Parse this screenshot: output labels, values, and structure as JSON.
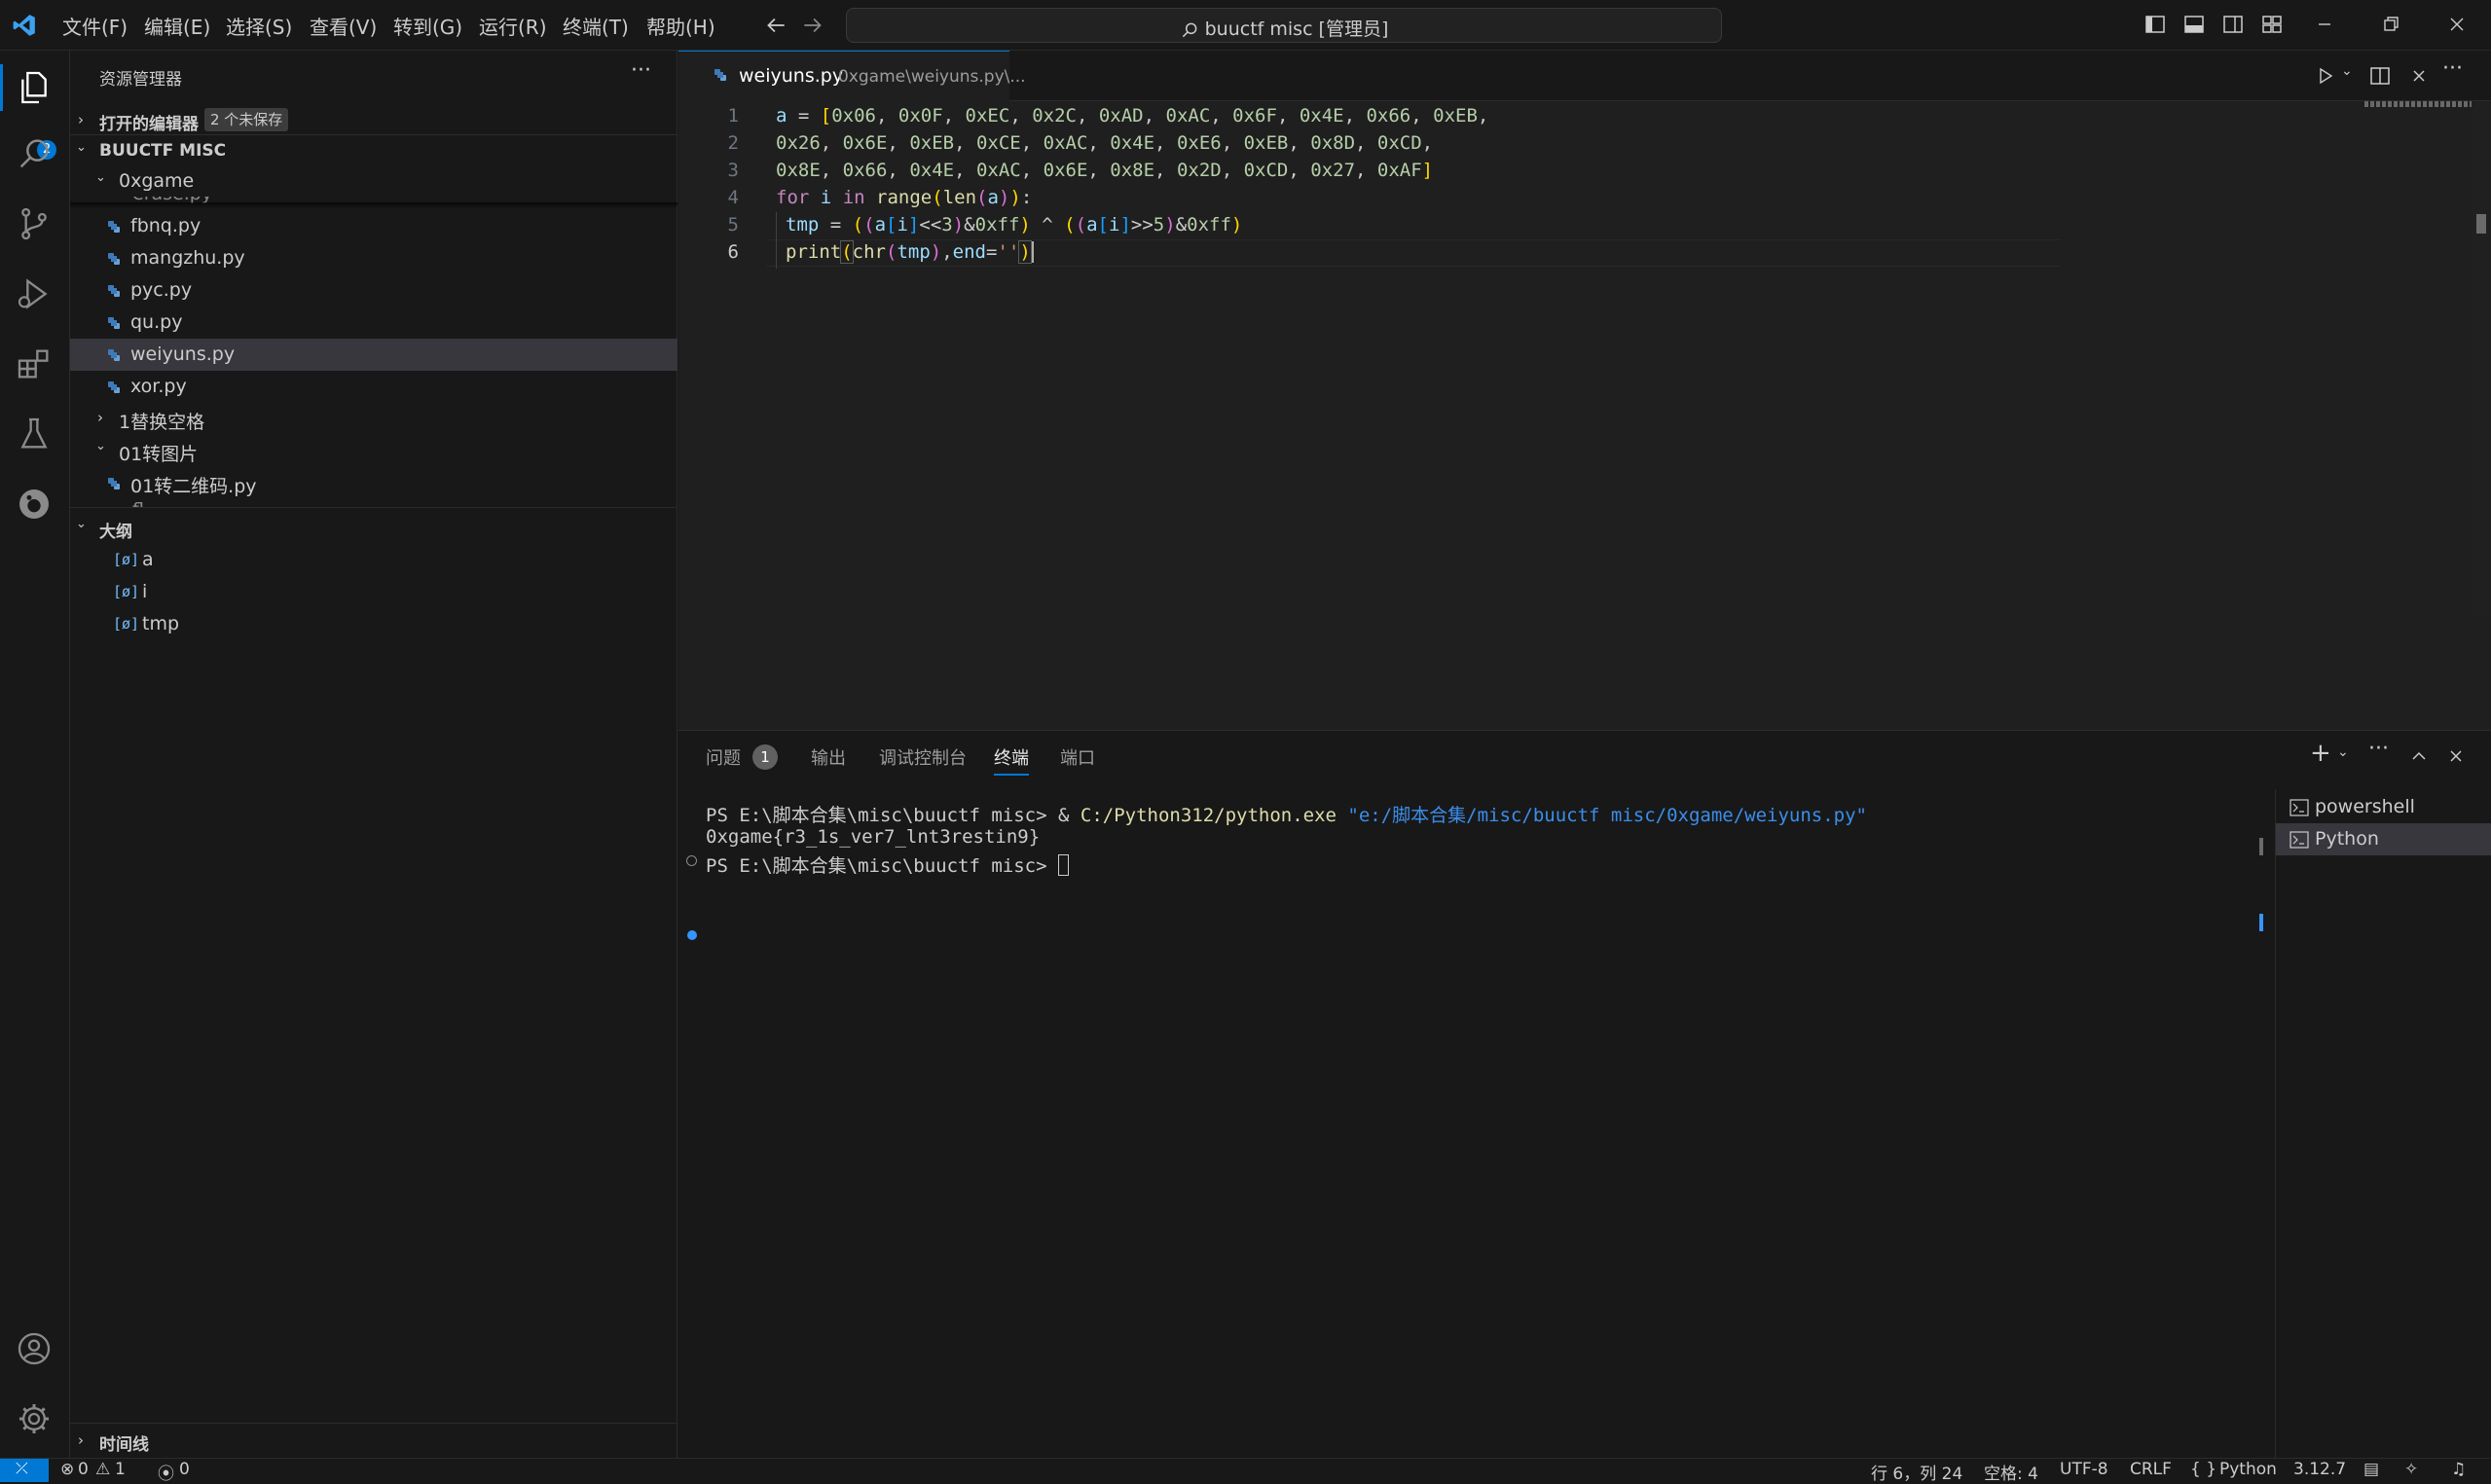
{
  "menu": [
    "文件(F)",
    "编辑(E)",
    "选择(S)",
    "查看(V)",
    "转到(G)",
    "运行(R)",
    "终端(T)",
    "帮助(H)"
  ],
  "command_center": "buuctf misc [管理员]",
  "activity": {
    "explorer_badge": "2"
  },
  "sidebar": {
    "title": "资源管理器",
    "open_editors": {
      "label": "打开的编辑器",
      "badge": "2 个未保存"
    },
    "workspace": "BUUCTF MISC",
    "folder": "0xgame",
    "partial_top": "erase.py",
    "files": [
      "fbnq.py",
      "mangzhu.py",
      "pyc.py",
      "qu.py",
      "weiyuns.py",
      "xor.py"
    ],
    "folder2": "1替换空格",
    "folder3": "01转图片",
    "file3": "01转二维码.py",
    "partial_bottom": "fl",
    "outline": {
      "label": "大纲",
      "symbols": [
        "a",
        "i",
        "tmp"
      ]
    },
    "timeline": "时间线"
  },
  "editor": {
    "tab_name": "weiyuns.py",
    "tab_path": "0xgame\\weiyuns.py\\...",
    "line_numbers": [
      "1",
      "2",
      "3",
      "4",
      "5",
      "6"
    ]
  },
  "panel": {
    "tabs": [
      "问题",
      "输出",
      "调试控制台",
      "终端",
      "端口"
    ],
    "problems_count": "1",
    "terminal": {
      "line1_prompt": "PS E:\\脚本合集\\misc\\buuctf misc> ",
      "line1_amp": "& ",
      "line1_exe": "C:/Python312/python.exe",
      "line1_arg": " \"e:/脚本合集/misc/buuctf misc/0xgame/weiyuns.py\"",
      "line2": "0xgame{r3_1s_ver7_lnt3restin9}",
      "line3": "PS E:\\脚本合集\\misc\\buuctf misc> "
    },
    "shells": [
      "powershell",
      "Python"
    ]
  },
  "status": {
    "errors": "0",
    "warnings": "1",
    "ports": "0",
    "position": "行 6，列 24",
    "spaces": "空格: 4",
    "encoding": "UTF-8",
    "eol": "CRLF",
    "language": "Python",
    "version": "3.12.7"
  }
}
